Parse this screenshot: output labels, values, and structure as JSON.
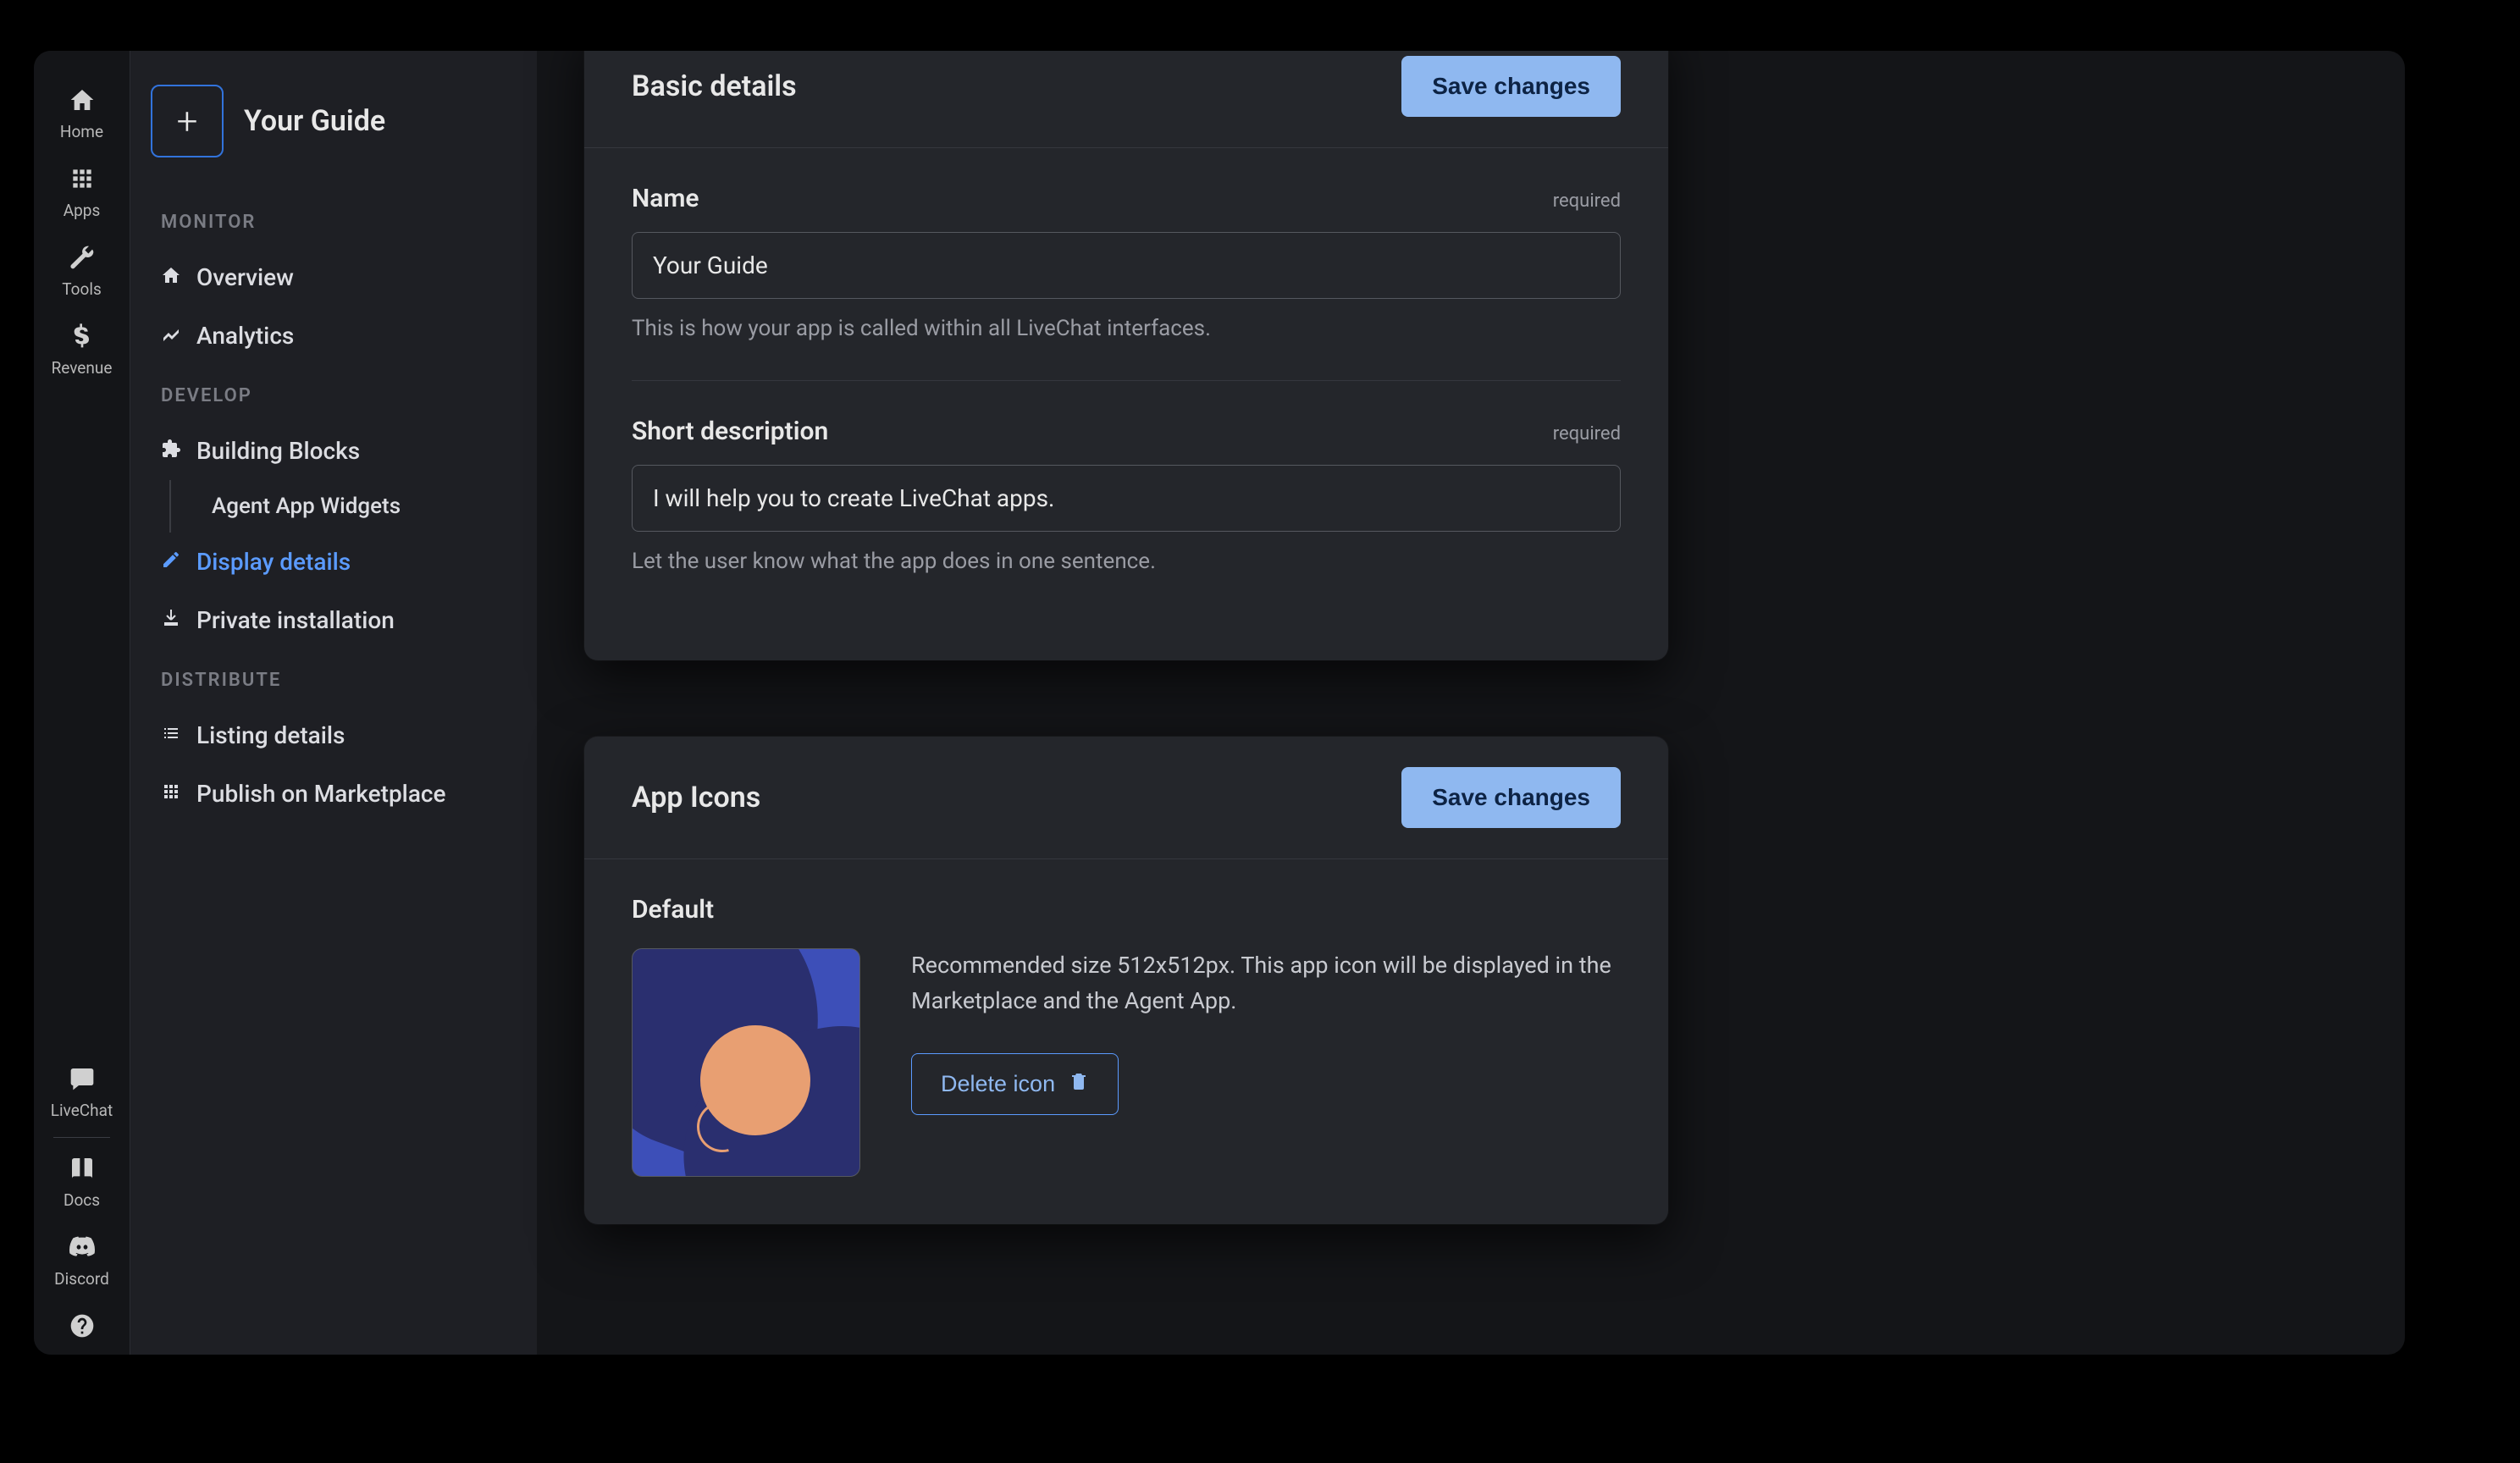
{
  "rail": {
    "home": "Home",
    "apps": "Apps",
    "tools": "Tools",
    "revenue": "Revenue",
    "livechat": "LiveChat",
    "docs": "Docs",
    "discord": "Discord"
  },
  "sidebar": {
    "app_name": "Your Guide",
    "sections": {
      "monitor": "Monitor",
      "develop": "Develop",
      "distribute": "Distribute"
    },
    "items": {
      "overview": "Overview",
      "analytics": "Analytics",
      "building_blocks": "Building Blocks",
      "agent_app_widgets": "Agent App Widgets",
      "display_details": "Display details",
      "private_installation": "Private installation",
      "listing_details": "Listing details",
      "publish_marketplace": "Publish on Marketplace"
    }
  },
  "basic": {
    "title": "Basic details",
    "save": "Save changes",
    "name_label": "Name",
    "name_value": "Your Guide",
    "name_helper": "This is how your app is called within all LiveChat interfaces.",
    "short_label": "Short description",
    "short_value": "I will help you to create LiveChat apps.",
    "short_helper": "Let the user know what the app does in one sentence.",
    "required": "required"
  },
  "icons": {
    "title": "App Icons",
    "save": "Save changes",
    "default_label": "Default",
    "desc": "Recommended size 512x512px. This app icon will be displayed in the Marketplace and the Agent App.",
    "delete": "Delete icon"
  }
}
